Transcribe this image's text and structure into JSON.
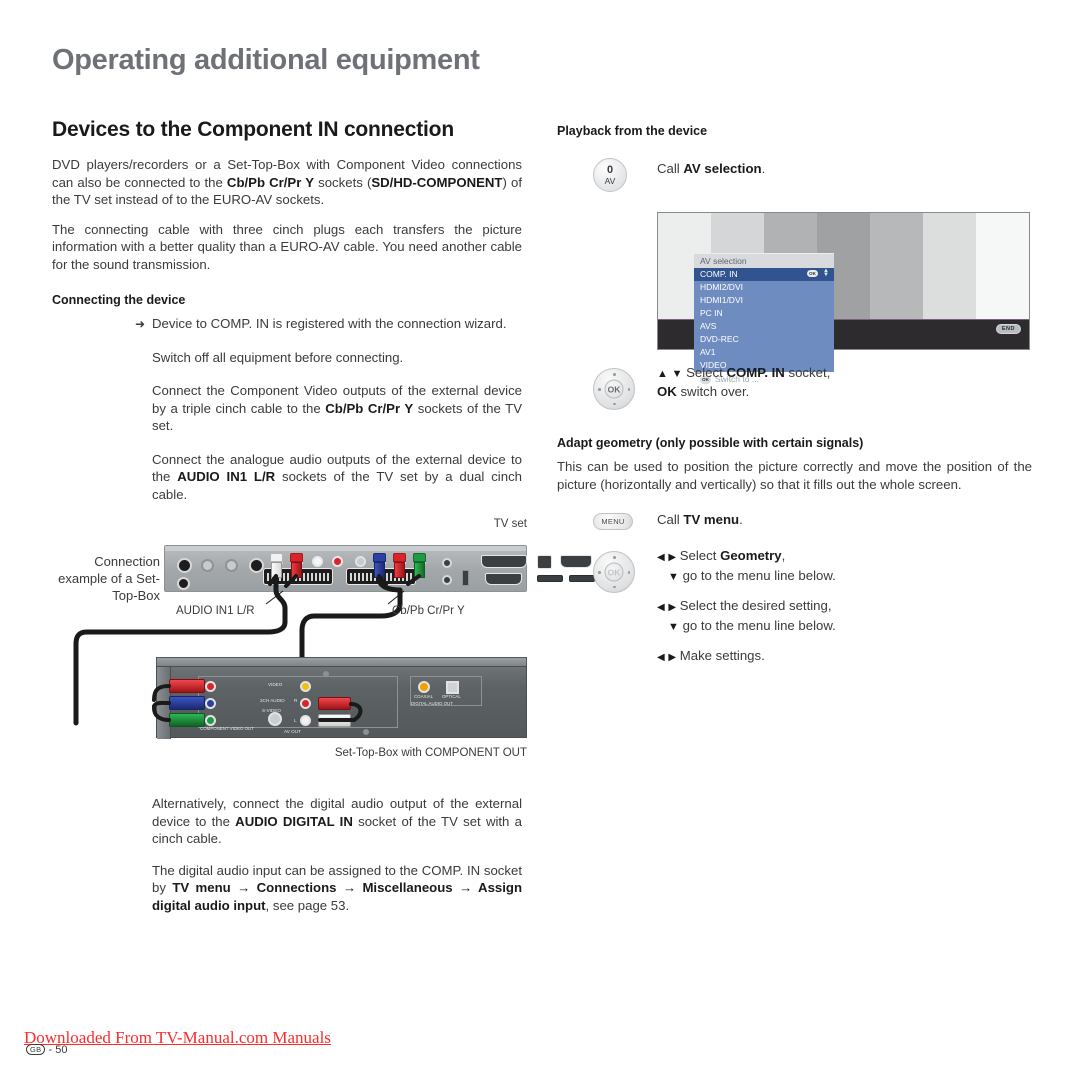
{
  "header": {
    "title": "Operating additional equipment"
  },
  "left": {
    "section_title": "Devices to the Component IN connection",
    "para1_a": "DVD players/recorders or a Set-Top-Box with Component Video connections can also be connected to the ",
    "para1_b": "Cb/Pb Cr/Pr Y",
    "para1_c": " sockets (",
    "para1_d": "SD/HD-COMPONENT",
    "para1_e": ") of the TV set instead of to the EURO-AV sockets.",
    "para2": "The connecting cable with three cinch plugs each transfers the picture information with a better quality than a EURO-AV cable. You need another cable for the sound transmission.",
    "sub_connecting": "Connecting the device",
    "ins1": "Device to COMP. IN is registered with the connection wizard.",
    "ins2": "Switch off all equipment before connecting.",
    "ins3_a": "Connect the Component Video outputs of the external device by a triple cinch cable to the ",
    "ins3_b": "Cb/Pb Cr/Pr Y",
    "ins3_c": " sockets of the TV set.",
    "ins4_a": "Connect the analogue audio outputs of the external device to the ",
    "ins4_b": "AUDIO IN1 L/R",
    "ins4_c": " sockets of the TV set by a dual cinch cable.",
    "ins5_a": "Alternatively, connect the digital audio output of the external device to the ",
    "ins5_b": "AUDIO DIGITAL IN",
    "ins5_c": " socket of the TV set with a cinch cable.",
    "ins6_a": "The digital audio input can be assigned to the COMP. IN socket by ",
    "ins6_b": "TV menu → Connections → Miscellaneous → Assign digital audio input",
    "ins6_c": ", see page 53.",
    "hand_glyph": "➜"
  },
  "diagram": {
    "label_tvset": "TV set",
    "label_connection_example": "Connection example of a Set-Top-Box",
    "label_audio_in": "AUDIO IN1 L/R",
    "label_cbpb": "Cb/Pb Cr/Pr Y",
    "label_stb": "Set-Top-Box with COMPONENT OUT",
    "stb_labels": {
      "video": "VIDEO",
      "ch_audio": "2CH AUDIO",
      "s_video": "S-VIDEO",
      "component": "COMPONENT VIDEO OUT",
      "av_out": "AV OUT",
      "coaxial": "COAXIAL",
      "optical": "OPTICAL",
      "digital_out": "DIGITAL AUDIO OUT",
      "r": "R",
      "l": "L"
    },
    "colors": {
      "white": "#f2f2f2",
      "red": "#d8242a",
      "blue": "#2b3fa5",
      "green": "#1f9c43",
      "yellow": "#f0c010"
    }
  },
  "right": {
    "sub_playback": "Playback from the device",
    "row1_pre": "Call ",
    "row1_bold": "AV selection",
    "row1_post": ".",
    "btn_av_top": "0",
    "btn_av_bottom": "AV",
    "row2_line1_pre": "Select ",
    "row2_line1_bold": "COMP. IN",
    "row2_line1_post": " socket,",
    "row2_line2_bold": "OK",
    "row2_line2_post": " switch over.",
    "sub_geometry": "Adapt geometry (only possible with certain signals)",
    "para_geometry": "This can be used to position the picture correctly and move the position of the picture (horizontally and vertically) so that it fills out the whole screen.",
    "btn_menu_label": "MENU",
    "row3_pre": "Call ",
    "row3_bold": "TV menu",
    "row3_post": ".",
    "row4_line1_pre": "Select ",
    "row4_line1_bold": "Geometry",
    "row4_line1_post": ",",
    "row4_line2": "go to the menu line below.",
    "row5_line1": "Select the desired setting,",
    "row5_line2": "go to the menu line below.",
    "row6_line1": "Make settings.",
    "ok_label": "OK",
    "arrow_up": "▲",
    "arrow_down": "▼",
    "arrow_left": "◀",
    "arrow_right": "▶"
  },
  "tvshot": {
    "menu_title": "AV selection",
    "items": [
      "COMP. IN",
      "HDMI2/DVI",
      "HDMI1/DVI",
      "PC IN",
      "AVS",
      "DVD-REC",
      "AV1",
      "VIDEO"
    ],
    "selected_index": 0,
    "ok_icon": "OK",
    "footer_text": "Switch to ...",
    "end_badge": "END",
    "bar_colors": [
      "#eceded",
      "#d5d6d7",
      "#b0b2b3",
      "#9fa1a2",
      "#b6b8b9",
      "#dcdddd",
      "#f6f7f7"
    ],
    "selected_color": "#31538f",
    "list_color": "#6f8cc0"
  },
  "footer": {
    "link": "Downloaded From TV-Manual.com Manuals",
    "region_badge": "GB",
    "page_number": "- 50"
  }
}
